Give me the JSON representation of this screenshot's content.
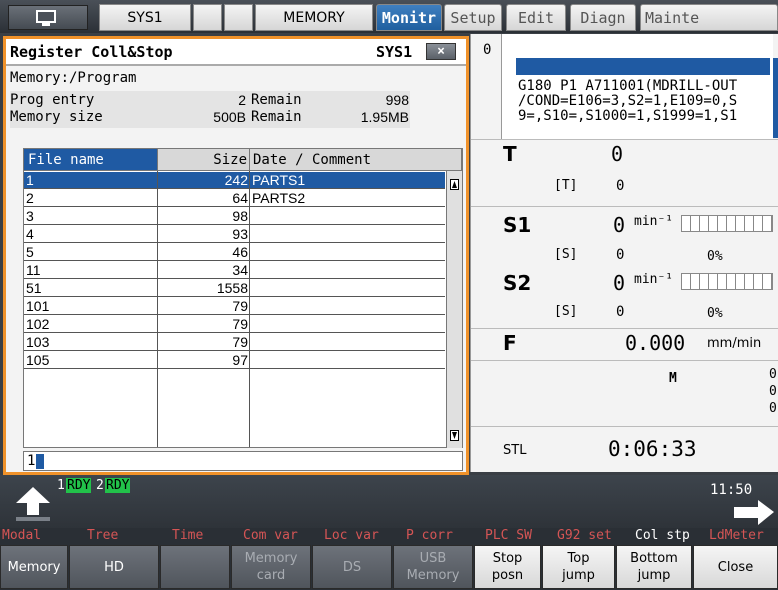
{
  "topbar": {
    "sys1_tab": "SYS1",
    "memory_tab": "MEMORY",
    "modes": [
      "Monitr",
      "Setup",
      "Edit",
      "Diagn",
      "Mainte"
    ]
  },
  "dialog": {
    "title": "Register Coll&Stop",
    "system": "SYS1",
    "close_glyph": "×",
    "path": "Memory:/Program",
    "prog_entry_label": "Prog entry",
    "prog_entry_value": "2",
    "remain1_label": "Remain",
    "remain1_value": "998",
    "memory_size_label": "Memory size",
    "memory_size_value": "500B",
    "remain2_label": "Remain",
    "remain2_value": "1.95MB",
    "col_name": "File name",
    "col_size": "Size",
    "col_date": "Date / Comment",
    "input_value": "1",
    "files": [
      {
        "name": "1",
        "size": "242",
        "comment": "PARTS1"
      },
      {
        "name": "2",
        "size": "64",
        "comment": "PARTS2"
      },
      {
        "name": "3",
        "size": "98",
        "comment": ""
      },
      {
        "name": "4",
        "size": "93",
        "comment": ""
      },
      {
        "name": "5",
        "size": "46",
        "comment": ""
      },
      {
        "name": "11",
        "size": "34",
        "comment": ""
      },
      {
        "name": "51",
        "size": "1558",
        "comment": ""
      },
      {
        "name": "101",
        "size": "79",
        "comment": ""
      },
      {
        "name": "102",
        "size": "79",
        "comment": ""
      },
      {
        "name": "103",
        "size": "79",
        "comment": ""
      },
      {
        "name": "105",
        "size": "97",
        "comment": ""
      }
    ]
  },
  "monitor": {
    "top_value": "0",
    "gcode_line1": "G180 P1 A711001(MDRILL-OUT",
    "gcode_line2": "/COND=E106=3,S2=1,E109=0,S",
    "gcode_line3": "9=,S10=,S1000=1,S1999=1,S1",
    "t_label": "T",
    "t_value": "0",
    "t_sub_label": "[T]",
    "t_sub_value": "0",
    "s1_label": "S1",
    "s1_value": "0",
    "s1_unit": "min⁻¹",
    "s1_sub_label": "[S]",
    "s1_sub_value": "0",
    "s1_percent": "0%",
    "s2_label": "S2",
    "s2_value": "0",
    "s2_unit": "min⁻¹",
    "s2_sub_label": "[S]",
    "s2_sub_value": "0",
    "s2_percent": "0%",
    "f_label": "F",
    "f_value": "0.000",
    "f_unit": "mm/min",
    "m_label": "M",
    "m_values": [
      "0",
      "0",
      "0"
    ],
    "stl_label": "STL",
    "time": "0:06:33"
  },
  "status": {
    "rdy1_num": "1",
    "rdy1": "RDY",
    "rdy2_num": "2",
    "rdy2": "RDY",
    "clock": "11:50"
  },
  "menu_row1": [
    "Modal",
    "Tree",
    "Time",
    "Com var",
    "Loc var",
    "P corr",
    "PLC SW",
    "G92 set",
    "Col stp",
    "LdMeter"
  ],
  "fkeys": {
    "memory": "Memory",
    "hd": "HD",
    "memory_card_1": "Memory",
    "memory_card_2": "card",
    "ds": "DS",
    "usb_1": "USB",
    "usb_2": "Memory",
    "stop_posn_1": "Stop",
    "stop_posn_2": "posn",
    "top_jump_1": "Top",
    "top_jump_2": "jump",
    "bottom_jump_1": "Bottom",
    "bottom_jump_2": "jump",
    "close": "Close"
  },
  "colors": {
    "accent_orange": "#f0922a",
    "selection_blue": "#1f5aa3",
    "rdy_green": "#22c24a",
    "menu_red": "#d55555"
  }
}
